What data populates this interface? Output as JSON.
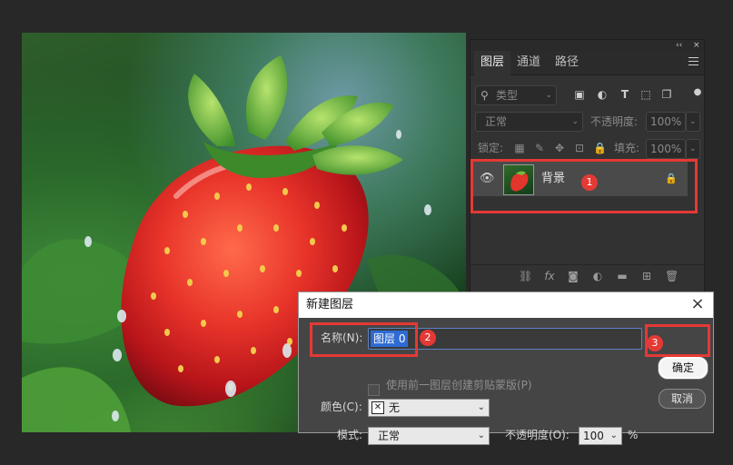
{
  "panel": {
    "topbar_collapse": "‹‹",
    "topbar_close": "×",
    "tabs": [
      "图层",
      "通道",
      "路径"
    ],
    "filter_placeholder": "类型",
    "blend_mode": "正常",
    "opacity_label": "不透明度:",
    "opacity_value": "100%",
    "lock_label": "锁定:",
    "fill_label": "填充:",
    "fill_value": "100%",
    "layer": {
      "name": "背景",
      "visible": true,
      "locked": true
    },
    "bottom_icons": [
      "link-icon",
      "fx-icon",
      "mask-icon",
      "adjustment-icon",
      "folder-icon",
      "new-layer-icon",
      "trash-icon"
    ],
    "fx_text": "fx"
  },
  "dialog": {
    "title": "新建图层",
    "close": "×",
    "name_label": "名称(N):",
    "name_value": "图层 0",
    "clip_label": "使用前一图层创建剪贴蒙版(P)",
    "color_label": "颜色(C):",
    "color_value": "无",
    "mode_label": "模式:",
    "mode_value": "正常",
    "opacity_label": "不透明度(O):",
    "opacity_value": "100",
    "opacity_unit": "%",
    "ok_label": "确定",
    "cancel_label": "取消"
  },
  "annotations": {
    "m1": "1",
    "m2": "2",
    "m3": "3"
  },
  "colors": {
    "annotation": "#e53935",
    "selection": "#2f6bd3"
  }
}
